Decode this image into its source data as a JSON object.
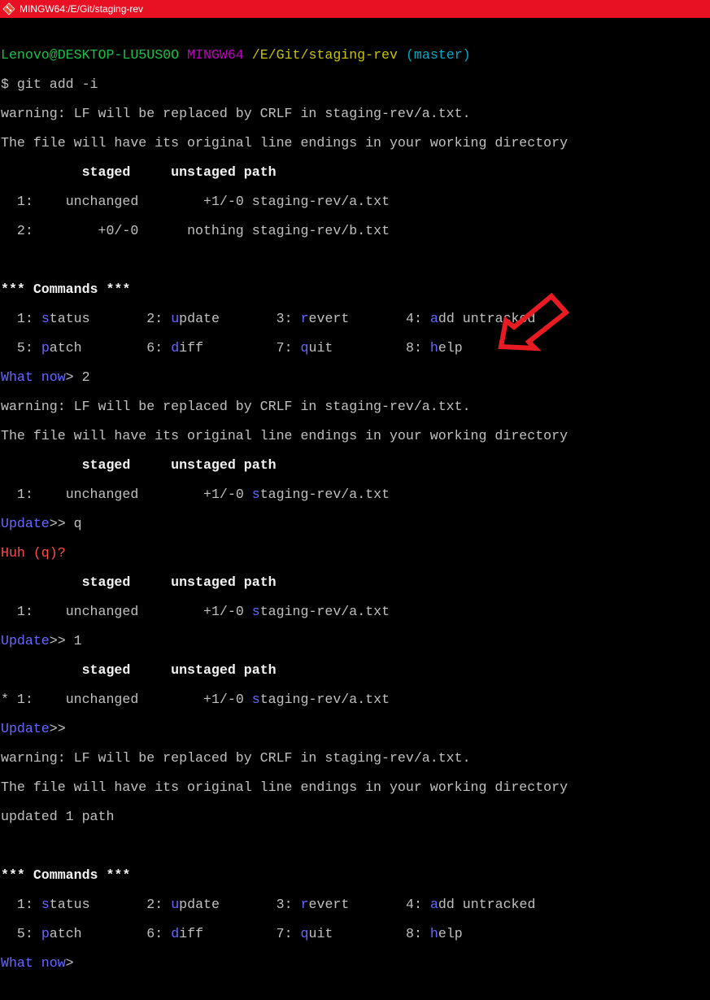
{
  "window": {
    "title": "MINGW64:/E/Git/staging-rev"
  },
  "prompt": {
    "user": "Lenovo@DESKTOP-LU5US0O",
    "system": "MINGW64",
    "path": "/E/Git/staging-rev",
    "branch": "(master)"
  },
  "cmd": "$ git add -i",
  "warn1": "warning: LF will be replaced by CRLF in staging-rev/a.txt.",
  "warn2": "The file will have its original line endings in your working directory",
  "header": {
    "staged": "staged",
    "unstaged": "unstaged",
    "path": "path"
  },
  "row_a": {
    "num": "1:",
    "staged": "unchanged",
    "unstaged": "+1/-0",
    "path": "staging-rev/a.txt"
  },
  "row_b": {
    "num": "2:",
    "staged": "+0/-0",
    "unstaged": "nothing",
    "path": "staging-rev/b.txt"
  },
  "commands_header": "*** Commands ***",
  "commands": [
    {
      "num": "1:",
      "first": "s",
      "rest": "tatus"
    },
    {
      "num": "2:",
      "first": "u",
      "rest": "pdate"
    },
    {
      "num": "3:",
      "first": "r",
      "rest": "evert"
    },
    {
      "num": "4:",
      "first": "a",
      "rest": "dd untracked"
    },
    {
      "num": "5:",
      "first": "p",
      "rest": "atch"
    },
    {
      "num": "6:",
      "first": "d",
      "rest": "iff"
    },
    {
      "num": "7:",
      "first": "q",
      "rest": "uit"
    },
    {
      "num": "8:",
      "first": "h",
      "rest": "elp"
    }
  ],
  "what_now": "What now",
  "inputs": {
    "what1": "> 2",
    "upd1": ">> q",
    "upd2": ">> 1",
    "upd3": ">>",
    "what2": ">"
  },
  "update_label": "Update",
  "huh": "Huh (q)?",
  "path_first": "s",
  "path_rest": "taging-rev/a.txt",
  "star_num": "* 1:",
  "updated_msg": "updated 1 path",
  "colors": {
    "titlebar": "#e81123",
    "annotation_arrow": "#e81b23"
  }
}
